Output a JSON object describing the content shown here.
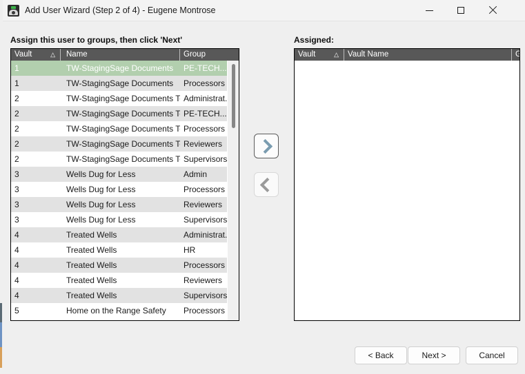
{
  "window": {
    "title": "Add User Wizard (Step 2 of 4) - Eugene Montrose",
    "icon": "vault-safe-icon",
    "controls": {
      "minimize": "minimize-icon",
      "maximize": "maximize-icon",
      "close": "close-icon"
    }
  },
  "left": {
    "label": "Assign this user to groups, then click 'Next'",
    "columns": [
      "Vault",
      "Name",
      "Group"
    ],
    "sort_indicator": "△",
    "rows": [
      {
        "vault": "1",
        "name": "TW-StagingSage Documents",
        "group": "PE-TECH...",
        "selected": true
      },
      {
        "vault": "1",
        "name": "TW-StagingSage Documents",
        "group": "Processors",
        "selected": false
      },
      {
        "vault": "2",
        "name": "TW-StagingSage Documents Test",
        "group": "Administrat...",
        "selected": false
      },
      {
        "vault": "2",
        "name": "TW-StagingSage Documents Test",
        "group": "PE-TECH...",
        "selected": false
      },
      {
        "vault": "2",
        "name": "TW-StagingSage Documents Test",
        "group": "Processors",
        "selected": false
      },
      {
        "vault": "2",
        "name": "TW-StagingSage Documents Test",
        "group": "Reviewers",
        "selected": false
      },
      {
        "vault": "2",
        "name": "TW-StagingSage Documents Test",
        "group": "Supervisors",
        "selected": false
      },
      {
        "vault": "3",
        "name": "Wells Dug for Less",
        "group": "Admin",
        "selected": false
      },
      {
        "vault": "3",
        "name": "Wells Dug for Less",
        "group": "Processors",
        "selected": false
      },
      {
        "vault": "3",
        "name": "Wells Dug for Less",
        "group": "Reviewers",
        "selected": false
      },
      {
        "vault": "3",
        "name": "Wells Dug for Less",
        "group": "Supervisors",
        "selected": false
      },
      {
        "vault": "4",
        "name": "Treated Wells",
        "group": "Administrat...",
        "selected": false
      },
      {
        "vault": "4",
        "name": "Treated Wells",
        "group": "HR",
        "selected": false
      },
      {
        "vault": "4",
        "name": "Treated Wells",
        "group": "Processors",
        "selected": false
      },
      {
        "vault": "4",
        "name": "Treated Wells",
        "group": "Reviewers",
        "selected": false
      },
      {
        "vault": "4",
        "name": "Treated Wells",
        "group": "Supervisors",
        "selected": false
      },
      {
        "vault": "5",
        "name": "Home on the Range Safety",
        "group": "Processors",
        "selected": false
      }
    ]
  },
  "right": {
    "label": "Assigned:",
    "columns": [
      "Vault",
      "Vault Name",
      "Group"
    ],
    "sort_indicator": "△",
    "rows": []
  },
  "transfer": {
    "add": "chevron-right-icon",
    "remove": "chevron-left-icon"
  },
  "footer": {
    "back": "< Back",
    "next": "Next >",
    "cancel": "Cancel"
  },
  "colors": {
    "selection": "#b2cfae",
    "header_bg": "#585858",
    "alt_row": "#e2e2e2",
    "accent_chevron": "#7a9cb0",
    "window_bg": "#efefef"
  }
}
